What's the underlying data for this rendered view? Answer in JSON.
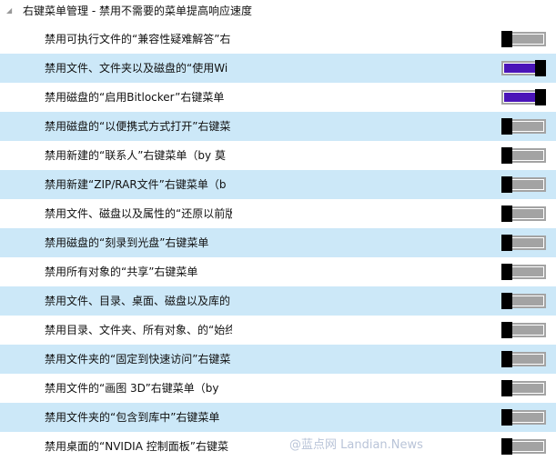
{
  "header": {
    "title": "右键菜单管理 - 禁用不需要的菜单提高响应速度"
  },
  "items": [
    {
      "label": "禁用可执行文件的“兼容性疑难解答”右",
      "on": false
    },
    {
      "label": "禁用文件、文件夹以及磁盘的“使用Wi",
      "on": true
    },
    {
      "label": "禁用磁盘的“启用Bitlocker”右键菜单",
      "on": true
    },
    {
      "label": "禁用磁盘的“以便携式方式打开”右键菜",
      "on": false
    },
    {
      "label": "禁用新建的“联系人”右键菜单（by 莫",
      "on": false
    },
    {
      "label": "禁用新建“ZIP/RAR文件”右键菜单（b",
      "on": false
    },
    {
      "label": "禁用文件、磁盘以及属性的“还原以前版",
      "on": false
    },
    {
      "label": "禁用磁盘的“刻录到光盘”右键菜单",
      "on": false
    },
    {
      "label": "禁用所有对象的“共享”右键菜单",
      "on": false
    },
    {
      "label": "禁用文件、目录、桌面、磁盘以及库的",
      "on": false
    },
    {
      "label": "禁用目录、文件夹、所有对象、的“始终",
      "on": false
    },
    {
      "label": "禁用文件夹的“固定到快速访问”右键菜",
      "on": false
    },
    {
      "label": "禁用文件的“画图 3D”右键菜单（by",
      "on": false
    },
    {
      "label": "禁用文件夹的“包含到库中”右键菜单",
      "on": false
    },
    {
      "label": "禁用桌面的“NVIDIA 控制面板”右键菜",
      "on": false
    }
  ],
  "watermark": "@蓝点网 Landian.News",
  "colors": {
    "on": "#4a14b8",
    "off": "#a3a3a3",
    "alt_row": "#cce8f8"
  }
}
